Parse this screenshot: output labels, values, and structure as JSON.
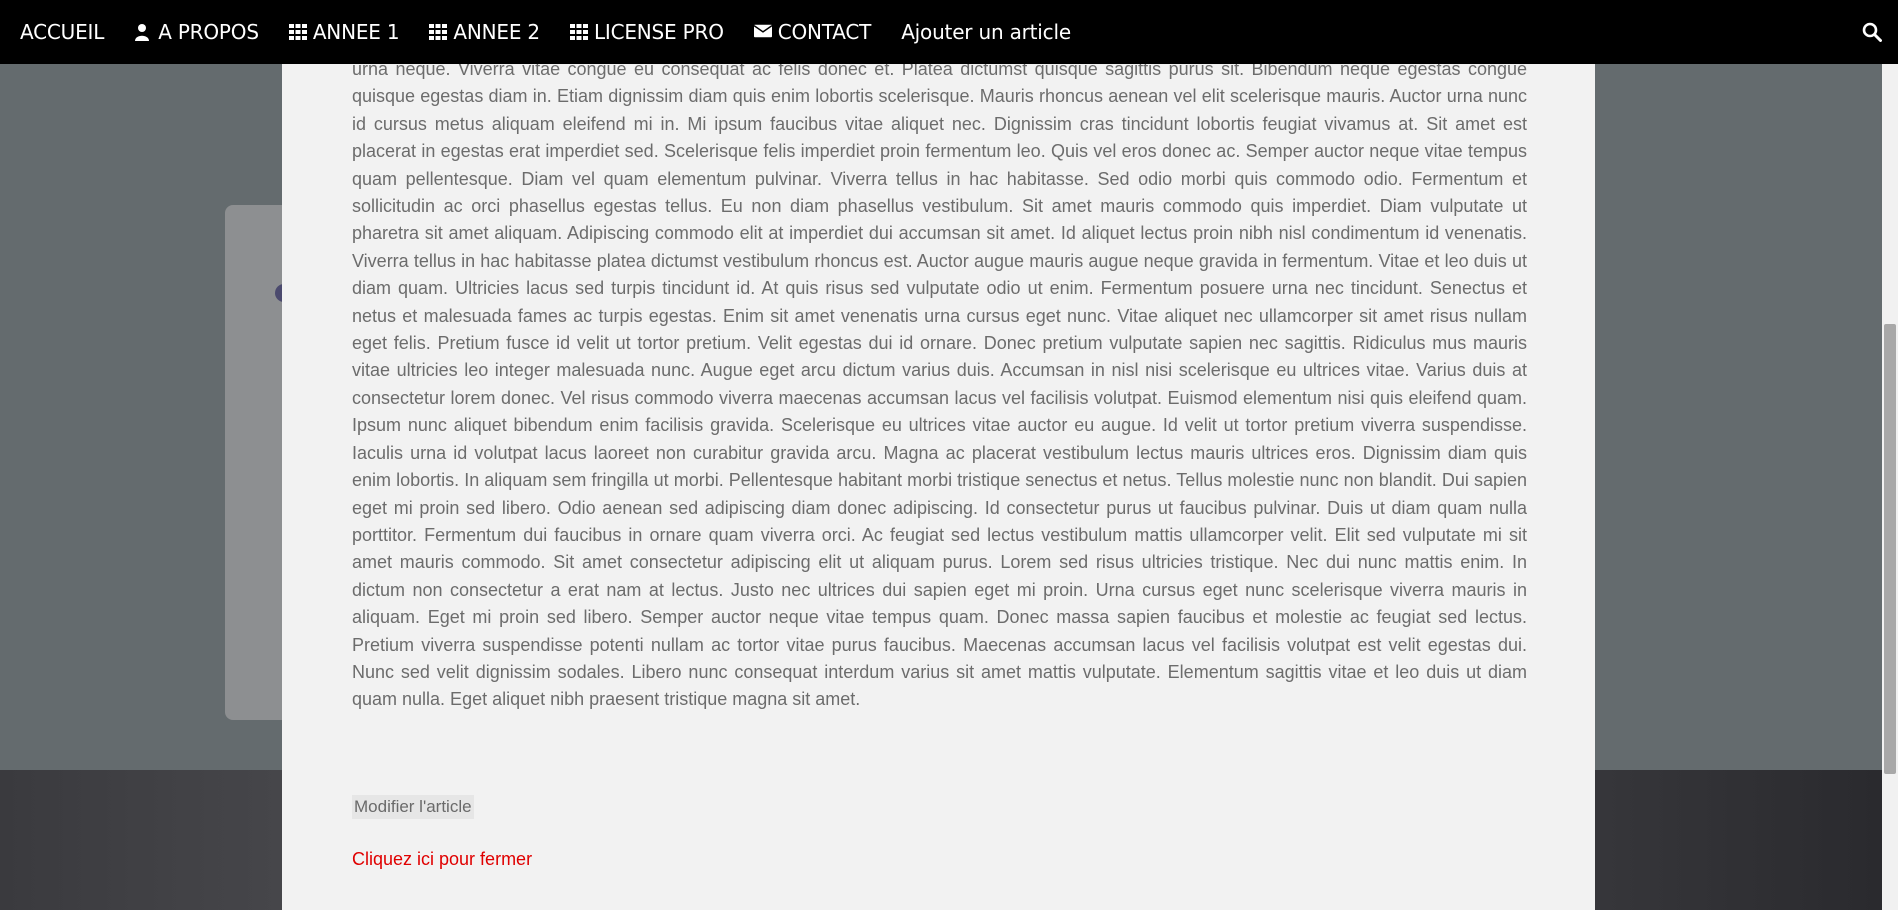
{
  "navbar": {
    "items": [
      {
        "label": "ACCUEIL",
        "icon": ""
      },
      {
        "label": "A PROPOS",
        "icon": "user-icon"
      },
      {
        "label": "ANNEE 1",
        "icon": "grid-icon"
      },
      {
        "label": "ANNEE 2",
        "icon": "grid-icon"
      },
      {
        "label": "LICENSE PRO",
        "icon": "grid-icon"
      },
      {
        "label": "CONTACT",
        "icon": "envelope-icon"
      },
      {
        "label": "Ajouter un article",
        "icon": ""
      }
    ],
    "search_icon": "search-icon"
  },
  "article": {
    "body": "urna neque. Viverra vitae congue eu consequat ac felis donec et. Platea dictumst quisque sagittis purus sit. Bibendum neque egestas congue quisque egestas diam in. Etiam dignissim diam quis enim lobortis scelerisque. Mauris rhoncus aenean vel elit scelerisque mauris. Auctor urna nunc id cursus metus aliquam eleifend mi in. Mi ipsum faucibus vitae aliquet nec. Dignissim cras tincidunt lobortis feugiat vivamus at. Sit amet est placerat in egestas erat imperdiet sed. Scelerisque felis imperdiet proin fermentum leo. Quis vel eros donec ac. Semper auctor neque vitae tempus quam pellentesque. Diam vel quam elementum pulvinar. Viverra tellus in hac habitasse. Sed odio morbi quis commodo odio. Fermentum et sollicitudin ac orci phasellus egestas tellus. Eu non diam phasellus vestibulum. Sit amet mauris commodo quis imperdiet. Diam vulputate ut pharetra sit amet aliquam. Adipiscing commodo elit at imperdiet dui accumsan sit amet. Id aliquet lectus proin nibh nisl condimentum id venenatis. Viverra tellus in hac habitasse platea dictumst vestibulum rhoncus est. Auctor augue mauris augue neque gravida in fermentum. Vitae et leo duis ut diam quam. Ultricies lacus sed turpis tincidunt id. At quis risus sed vulputate odio ut enim. Fermentum posuere urna nec tincidunt. Senectus et netus et malesuada fames ac turpis egestas. Enim sit amet venenatis urna cursus eget nunc. Vitae aliquet nec ullamcorper sit amet risus nullam eget felis. Pretium fusce id velit ut tortor pretium. Velit egestas dui id ornare. Donec pretium vulputate sapien nec sagittis. Ridiculus mus mauris vitae ultricies leo integer malesuada nunc. Augue eget arcu dictum varius duis. Accumsan in nisl nisi scelerisque eu ultrices vitae. Varius duis at consectetur lorem donec. Vel risus commodo viverra maecenas accumsan lacus vel facilisis volutpat. Euismod elementum nisi quis eleifend quam. Ipsum nunc aliquet bibendum enim facilisis gravida. Scelerisque eu ultrices vitae auctor eu augue. Id velit ut tortor pretium viverra suspendisse. Iaculis urna id volutpat lacus laoreet non curabitur gravida arcu. Magna ac placerat vestibulum lectus mauris ultrices eros. Dignissim diam quis enim lobortis. In aliquam sem fringilla ut morbi. Pellentesque habitant morbi tristique senectus et netus. Tellus molestie nunc non blandit. Dui sapien eget mi proin sed libero. Odio aenean sed adipiscing diam donec adipiscing. Id consectetur purus ut faucibus pulvinar. Duis ut diam quam nulla porttitor. Fermentum dui faucibus in ornare quam viverra orci. Ac feugiat sed lectus vestibulum mattis ullamcorper velit. Elit sed vulputate mi sit amet mauris commodo. Sit amet consectetur adipiscing elit ut aliquam purus. Lorem sed risus ultricies tristique. Nec dui nunc mattis enim. In dictum non consectetur a erat nam at lectus. Justo nec ultrices dui sapien eget mi proin. Urna cursus eget nunc scelerisque viverra mauris in aliquam. Eget mi proin sed libero. Semper auctor neque vitae tempus quam. Donec massa sapien faucibus et molestie ac feugiat sed lectus. Pretium viverra suspendisse potenti nullam ac tortor vitae purus faucibus. Maecenas accumsan lacus vel facilisis volutpat est velit egestas dui. Nunc sed velit dignissim sodales. Libero nunc consequat interdum varius sit amet mattis vulputate. Elementum sagittis vitae et leo duis ut diam quam nulla. Eget aliquet nibh praesent tristique magna sit amet.",
    "edit_label": "Modifier l'article",
    "close_label": "Cliquez ici pour fermer"
  },
  "colors": {
    "navbar_bg": "#000000",
    "close_link": "#e00000",
    "body_text": "#6c6c6c",
    "modal_bg": "#f2f2f2"
  }
}
